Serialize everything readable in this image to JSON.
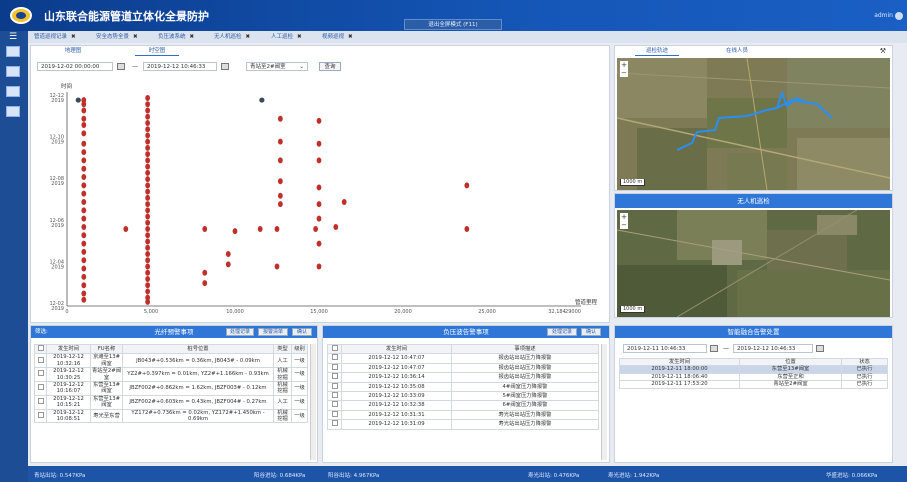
{
  "app": {
    "title": "山东联合能源管道立体化全景防护",
    "fullscreen_label": "退出全屏模式 (F11)",
    "user": "admin"
  },
  "tabs": [
    {
      "label": "管道巡视记录"
    },
    {
      "label": "安全态势全景"
    },
    {
      "label": "负压波系统"
    },
    {
      "label": "无人机巡检"
    },
    {
      "label": "人工巡检"
    },
    {
      "label": "视频巡视"
    }
  ],
  "left_panel": {
    "subtabs": [
      "地理图",
      "时空图"
    ],
    "start_time": "2019-12-02 00:00:00",
    "end_time": "2019-12-12 10:46:33",
    "dash": "—",
    "segment": "青站至2#阀室",
    "query_label": "查询"
  },
  "chart_data": {
    "type": "scatter",
    "ylabel": "时间",
    "xlabel": "管道里程",
    "xlim": [
      0,
      30000
    ],
    "x_ticks": [
      "0",
      "5,000",
      "10,000",
      "15,000",
      "20,000",
      "25,000"
    ],
    "x_last_tick": "29000",
    "x_extra_label": "32,184",
    "y_ticks": [
      "12-12\n2019",
      "12-10\n2019",
      "12-08\n2019",
      "12-06\n2019",
      "12-04\n2019",
      "12-02\n2019"
    ],
    "point_color": "#c0302b",
    "highlight_color": "#3a4a5a",
    "series": [
      {
        "name": "",
        "points": [
          [
            1000,
            0.99
          ],
          [
            1000,
            0.97
          ],
          [
            1000,
            0.94
          ],
          [
            1000,
            0.9
          ],
          [
            1000,
            0.87
          ],
          [
            1000,
            0.83
          ],
          [
            1000,
            0.78
          ],
          [
            1000,
            0.74
          ],
          [
            1000,
            0.7
          ],
          [
            1000,
            0.66
          ],
          [
            1000,
            0.62
          ],
          [
            1000,
            0.58
          ],
          [
            1000,
            0.54
          ],
          [
            1000,
            0.5
          ],
          [
            1000,
            0.46
          ],
          [
            1000,
            0.42
          ],
          [
            1000,
            0.38
          ],
          [
            1000,
            0.34
          ],
          [
            1000,
            0.3
          ],
          [
            1000,
            0.26
          ],
          [
            1000,
            0.22
          ],
          [
            1000,
            0.18
          ],
          [
            1000,
            0.14
          ],
          [
            1000,
            0.1
          ],
          [
            1000,
            0.06
          ],
          [
            1000,
            0.03
          ],
          [
            4800,
            1.0
          ],
          [
            4800,
            0.97
          ],
          [
            4800,
            0.94
          ],
          [
            4800,
            0.91
          ],
          [
            4800,
            0.88
          ],
          [
            4800,
            0.85
          ],
          [
            4800,
            0.82
          ],
          [
            4800,
            0.79
          ],
          [
            4800,
            0.76
          ],
          [
            4800,
            0.73
          ],
          [
            4800,
            0.7
          ],
          [
            4800,
            0.67
          ],
          [
            4800,
            0.64
          ],
          [
            4800,
            0.61
          ],
          [
            4800,
            0.58
          ],
          [
            4800,
            0.55
          ],
          [
            4800,
            0.52
          ],
          [
            4800,
            0.49
          ],
          [
            4800,
            0.46
          ],
          [
            4800,
            0.43
          ],
          [
            4800,
            0.4
          ],
          [
            4800,
            0.37
          ],
          [
            4800,
            0.34
          ],
          [
            4800,
            0.31
          ],
          [
            4800,
            0.28
          ],
          [
            4800,
            0.25
          ],
          [
            4800,
            0.22
          ],
          [
            4800,
            0.19
          ],
          [
            4800,
            0.16
          ],
          [
            4800,
            0.13
          ],
          [
            4800,
            0.1
          ],
          [
            4800,
            0.07
          ],
          [
            4800,
            0.04
          ],
          [
            4800,
            0.02
          ],
          [
            3500,
            0.37
          ],
          [
            8200,
            0.37
          ],
          [
            8200,
            0.16
          ],
          [
            8200,
            0.11
          ],
          [
            9600,
            0.25
          ],
          [
            9600,
            0.2
          ],
          [
            10000,
            0.36
          ],
          [
            11500,
            0.37
          ],
          [
            12500,
            0.37
          ],
          [
            12500,
            0.19
          ],
          [
            12700,
            0.49
          ],
          [
            12700,
            0.53
          ],
          [
            12700,
            0.6
          ],
          [
            12700,
            0.7
          ],
          [
            12700,
            0.79
          ],
          [
            12700,
            0.9
          ],
          [
            14800,
            0.37
          ],
          [
            15000,
            0.19
          ],
          [
            15000,
            0.3
          ],
          [
            15000,
            0.42
          ],
          [
            15000,
            0.49
          ],
          [
            15000,
            0.57
          ],
          [
            15000,
            0.7
          ],
          [
            15000,
            0.78
          ],
          [
            15000,
            0.89
          ],
          [
            16000,
            0.38
          ],
          [
            16500,
            0.5
          ],
          [
            23800,
            0.37
          ],
          [
            23800,
            0.58
          ]
        ]
      },
      {
        "name": "",
        "points": [
          [
            670,
            0.99
          ],
          [
            11600,
            0.99
          ]
        ]
      }
    ]
  },
  "fiber_panel": {
    "filter_label": "筛选:",
    "title": "光纤预警事项",
    "buttons": [
      "处理记录",
      "报警清单",
      "确认"
    ],
    "columns": [
      "",
      "发生时间",
      "FU名称",
      "桩号位置",
      "类型",
      "级别"
    ],
    "rows": [
      [
        "2019-12-12 10:32:16",
        "京潍至13#阀室",
        "JB043#+0.536km = 0.36km, JB043# - 0.09km",
        "人工",
        "一级"
      ],
      [
        "2019-12-12 10:30:25",
        "青站至2#阀室",
        "YZ2#+0.397km = 0.01km, YZ2#+1.166km - 0.93km",
        "机械挖掘",
        "一级"
      ],
      [
        "2019-12-12 10:16:07",
        "东营至13#阀室",
        "JBZF002#+0.862km = 1.62km, JBZF003# - 0.12km",
        "机械挖掘",
        "一级"
      ],
      [
        "2019-12-12 10:15:21",
        "东营至13#阀室",
        "JBZF002#+0.603km = 0.43km, JBZF004# - 0.27km",
        "人工",
        "一级"
      ],
      [
        "2019-12-12 10:08:51",
        "寿光至东营",
        "YZ172#+0.736km = 0.02km, YZ172#+1.450km - 0.69km",
        "机械挖掘",
        "一级"
      ]
    ]
  },
  "pressure_panel": {
    "title": "负压波告警事项",
    "buttons": [
      "处理记录",
      "确认"
    ],
    "columns": [
      "",
      "发生时间",
      "事项描述"
    ],
    "rows": [
      [
        "2019-12-12 10:47:07",
        "报齿站出站压力降报警"
      ],
      [
        "2019-12-12 10:47:07",
        "报齿站出站压力降报警"
      ],
      [
        "2019-12-12 10:36:14",
        "报齿站出站压力降报警"
      ],
      [
        "2019-12-12 10:35:08",
        "4#阀室压力降报警"
      ],
      [
        "2019-12-12 10:33:09",
        "5#阀室压力降报警"
      ],
      [
        "2019-12-12 10:32:38",
        "6#阀室压力降报警"
      ],
      [
        "2019-12-12 10:31:31",
        "寿光站出站压力降报警"
      ],
      [
        "2019-12-12 10:31:09",
        "寿光站出站压力降报警"
      ]
    ]
  },
  "right_top": {
    "tabs": [
      "巡检轨迹",
      "在线人员"
    ],
    "scale": "1000 m"
  },
  "uav_panel": {
    "title": "无人机巡检",
    "scale": "1000 m"
  },
  "fusion_panel": {
    "title": "智能融合告警处置",
    "start_time": "2019-12-11 10:46:33",
    "end_time": "2019-12-12 10:46:33",
    "dash": "—",
    "columns": [
      "发生时间",
      "位置",
      "状态"
    ],
    "rows": [
      [
        "2019-12-11 18:00:00",
        "东营至13#阀室",
        "已执行"
      ],
      [
        "2019-12-11 18:06:40",
        "东营至正和",
        "已执行"
      ],
      [
        "2019-12-11 17:53:20",
        "青站至2#阀室",
        "已执行"
      ]
    ]
  },
  "statusbar": [
    {
      "text": "青站出站: 0.547KPa"
    },
    {
      "text": "阳谷进站: 0.684KPa"
    },
    {
      "text": "阳谷出站: 4.967KPa"
    },
    {
      "text": "寿光出站: 0.476KPa"
    },
    {
      "text": "寿光进站: 1.942KPa"
    },
    {
      "text": "华盛进站: 0.066KPa"
    }
  ]
}
